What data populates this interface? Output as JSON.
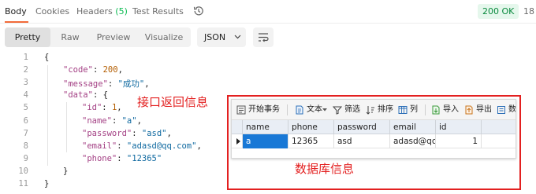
{
  "response_tabs": {
    "body": "Body",
    "cookies": "Cookies",
    "headers": "Headers",
    "headers_count": "(5)",
    "test_results": "Test Results",
    "status": "200 OK",
    "time_fragment": "18"
  },
  "view_toolbar": {
    "pretty": "Pretty",
    "raw": "Raw",
    "preview": "Preview",
    "visualize": "Visualize",
    "format": "JSON"
  },
  "code": {
    "line_numbers": [
      "1",
      "2",
      "3",
      "4",
      "5",
      "6",
      "7",
      "8",
      "9",
      "10",
      "11"
    ],
    "lines": [
      [
        {
          "t": "{",
          "c": "p"
        }
      ],
      [
        {
          "t": "\"code\"",
          "c": "k"
        },
        {
          "t": ": ",
          "c": "p"
        },
        {
          "t": "200",
          "c": "n"
        },
        {
          "t": ",",
          "c": "p"
        }
      ],
      [
        {
          "t": "\"message\"",
          "c": "k"
        },
        {
          "t": ": ",
          "c": "p"
        },
        {
          "t": "\"成功\"",
          "c": "s"
        },
        {
          "t": ",",
          "c": "p"
        }
      ],
      [
        {
          "t": "\"data\"",
          "c": "k"
        },
        {
          "t": ": {",
          "c": "p"
        }
      ],
      [
        {
          "t": "\"id\"",
          "c": "k"
        },
        {
          "t": ": ",
          "c": "p"
        },
        {
          "t": "1",
          "c": "n"
        },
        {
          "t": ",",
          "c": "p"
        }
      ],
      [
        {
          "t": "\"name\"",
          "c": "k"
        },
        {
          "t": ": ",
          "c": "p"
        },
        {
          "t": "\"a\"",
          "c": "s"
        },
        {
          "t": ",",
          "c": "p"
        }
      ],
      [
        {
          "t": "\"password\"",
          "c": "k"
        },
        {
          "t": ": ",
          "c": "p"
        },
        {
          "t": "\"asd\"",
          "c": "s"
        },
        {
          "t": ",",
          "c": "p"
        }
      ],
      [
        {
          "t": "\"email\"",
          "c": "k"
        },
        {
          "t": ": ",
          "c": "p"
        },
        {
          "t": "\"adasd@qq.com\"",
          "c": "s"
        },
        {
          "t": ",",
          "c": "p"
        }
      ],
      [
        {
          "t": "\"phone\"",
          "c": "k"
        },
        {
          "t": ": ",
          "c": "p"
        },
        {
          "t": "\"12365\"",
          "c": "s"
        }
      ],
      [
        {
          "t": "}",
          "c": "p"
        }
      ],
      [
        {
          "t": "}",
          "c": "p"
        }
      ]
    ]
  },
  "annotations": {
    "interface_info": "接口返回信息",
    "database_info": "数据库信息"
  },
  "db_grid": {
    "toolbar": {
      "begin_transaction": "开始事务",
      "text": "文本",
      "filter": "筛选",
      "sort": "排序",
      "columns": "列",
      "import": "导入",
      "export": "导出",
      "data": "数"
    },
    "columns": [
      "name",
      "phone",
      "password",
      "email",
      "id"
    ],
    "rows": [
      [
        "a",
        "12365",
        "asd",
        "adasd@qc",
        "1"
      ]
    ]
  },
  "colors": {
    "accent_tab": "#f26b3a",
    "status_green": "#0cbb52",
    "annotation_red": "#e32020",
    "selected_cell": "#1878d6"
  }
}
